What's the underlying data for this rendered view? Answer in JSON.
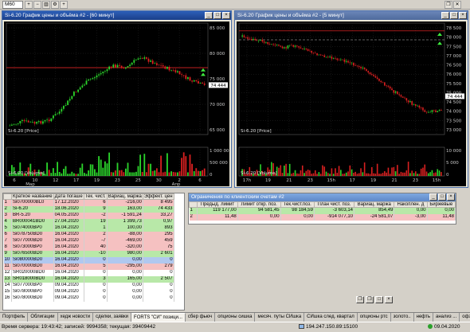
{
  "toolbar": {
    "interval": "M60"
  },
  "chart1": {
    "title": "Si-6.20 График цены и объёма #2 - [60 минут]",
    "legend_price": "Si-6.20 [Price]",
    "legend_volume": "Si-6.20 [Volume]",
    "price_ticks": [
      "85 000",
      "80 000",
      "75 000",
      "70 000",
      "65 000"
    ],
    "current_price": "74 444",
    "volume_ticks": [
      "1 000 000",
      "500 000",
      "0"
    ],
    "time_labels": [
      "6",
      "10",
      "12",
      "17",
      "19",
      "23",
      "25",
      "30",
      "2",
      "6"
    ],
    "month_labels": [
      "Мар",
      "Апр"
    ]
  },
  "chart2": {
    "title": "Si-6.20 График цены и объёма #2 - [5 минут]",
    "legend_price": "Si-6.20 [Price]",
    "legend_volume": "Si-6.20 [Volume]",
    "price_ticks": [
      "78 500",
      "78 000",
      "77 500",
      "77 000",
      "76 500",
      "76 000",
      "75 500",
      "75 000",
      "74 500",
      "74 000",
      "73 500",
      "73 000"
    ],
    "current_price": "74 444",
    "volume_ticks": [
      "10 000",
      "5 000",
      "0"
    ],
    "time_labels": [
      "17h",
      "19",
      "21",
      "23",
      "15h",
      "17",
      "19",
      "21",
      "23",
      "15h"
    ]
  },
  "table": {
    "headers": [
      "",
      "Краткое название",
      "Дата погаше",
      "Тек. чист.",
      "Вариац. маржа",
      "Эффект. цен"
    ],
    "rows": [
      {
        "n": "1",
        "name": "Si0700000BL0",
        "date": "17.12.2020",
        "pos": "6",
        "margin": "-216,00",
        "eff": "8 495",
        "color": "red"
      },
      {
        "n": "2",
        "name": "Si-6.20",
        "date": "18.06.2020",
        "pos": "9",
        "margin": "163,00",
        "eff": "74 433",
        "color": "green"
      },
      {
        "n": "3",
        "name": "BR-5.20",
        "date": "04.05.2020",
        "pos": "-2",
        "margin": "-1 591,24",
        "eff": "33,27",
        "color": "red"
      },
      {
        "n": "4",
        "name": "BR000041BD0",
        "date": "27.04.2020",
        "pos": "19",
        "margin": "1 399,73",
        "eff": "0,97",
        "color": "green"
      },
      {
        "n": "5",
        "name": "Si074000BP0",
        "date": "16.04.2020",
        "pos": "1",
        "margin": "100,00",
        "eff": "893",
        "color": "green"
      },
      {
        "n": "6",
        "name": "Si078750BD0",
        "date": "16.04.2020",
        "pos": "2",
        "margin": "-88,00",
        "eff": "295",
        "color": "red"
      },
      {
        "n": "7",
        "name": "Si077000BD0",
        "date": "16.04.2020",
        "pos": "-7",
        "margin": "-469,00",
        "eff": "459",
        "color": "red"
      },
      {
        "n": "8",
        "name": "Si073000BP0",
        "date": "16.04.2020",
        "pos": "40",
        "margin": "-320,00",
        "eff": "75",
        "color": "red"
      },
      {
        "n": "9",
        "name": "Si076500BD0",
        "date": "16.04.2020",
        "pos": "-10",
        "margin": "980,00",
        "eff": "2 601",
        "color": "green"
      },
      {
        "n": "10",
        "name": "Si080000BD0",
        "date": "16.04.2020",
        "pos": "0",
        "margin": "0,00",
        "eff": "0",
        "color": "sel"
      },
      {
        "n": "11",
        "name": "Si070000BD0",
        "date": "16.04.2020",
        "pos": "5",
        "margin": "-295,00",
        "eff": "279",
        "color": "red"
      },
      {
        "n": "12",
        "name": "SR020000BD0",
        "date": "16.04.2020",
        "pos": "0",
        "margin": "0,00",
        "eff": "0",
        "color": "plain"
      },
      {
        "n": "13",
        "name": "SR018000BD0",
        "date": "16.04.2020",
        "pos": "3",
        "margin": "165,00",
        "eff": "2 507",
        "color": "green"
      },
      {
        "n": "14",
        "name": "Si077000BP0",
        "date": "09.04.2020",
        "pos": "0",
        "margin": "0,00",
        "eff": "0",
        "color": "plain"
      },
      {
        "n": "15",
        "name": "Si078000BP0",
        "date": "09.04.2020",
        "pos": "0",
        "margin": "0,00",
        "eff": "0",
        "color": "plain"
      },
      {
        "n": "16",
        "name": "Si078000BD0",
        "date": "09.04.2020",
        "pos": "0",
        "margin": "0,00",
        "eff": "0",
        "color": "plain"
      }
    ]
  },
  "limits": {
    "title": "Ограничения по клиентским счетам #2",
    "headers": [
      "",
      "Предыд. лимит",
      "Лимит откр. поз.",
      "Тек.чист.поз.",
      "План чист. поз.",
      "Вариац. маржа",
      "Накоплен. д",
      "Биржевые"
    ],
    "rows": [
      {
        "n": "1",
        "c1": "119 177,00",
        "c2": "94 581,45",
        "c3": "98 184,59",
        "c4": "-3 603,14",
        "c5": "854,49",
        "c6": "0,00",
        "c7": "0,00",
        "color": "green"
      },
      {
        "n": "2",
        "c1": "11,48",
        "c2": "0,00",
        "c3": "0,00",
        "c4": "-914 077,10",
        "c5": "-24 581,07",
        "c6": "-3,00",
        "c7": "11,48",
        "color": "red"
      }
    ]
  },
  "tabs": [
    "Портфель",
    "Облигации",
    "хедж новости",
    "сделки, заявки",
    "FORTS \"СИ\" позици...",
    "сбер фьюч",
    "опционы сишка",
    "месяч. путы СИшка",
    "СИшка след. квартал",
    "опционы ртс",
    "золото..",
    "нефть",
    "анализ ...",
    "офз фьючи"
  ],
  "status": {
    "server_time": "Время сервера: 19:43:42; записей: 9994358; текущая: 39409442",
    "connection": "194.247.150.89:15100",
    "date": "09.04.2020"
  },
  "colors": {
    "up": "#2bd42b",
    "down": "#e02020",
    "level": "#ff2a2a",
    "volume_up": "#2bd42b",
    "volume_down": "#d82020"
  }
}
